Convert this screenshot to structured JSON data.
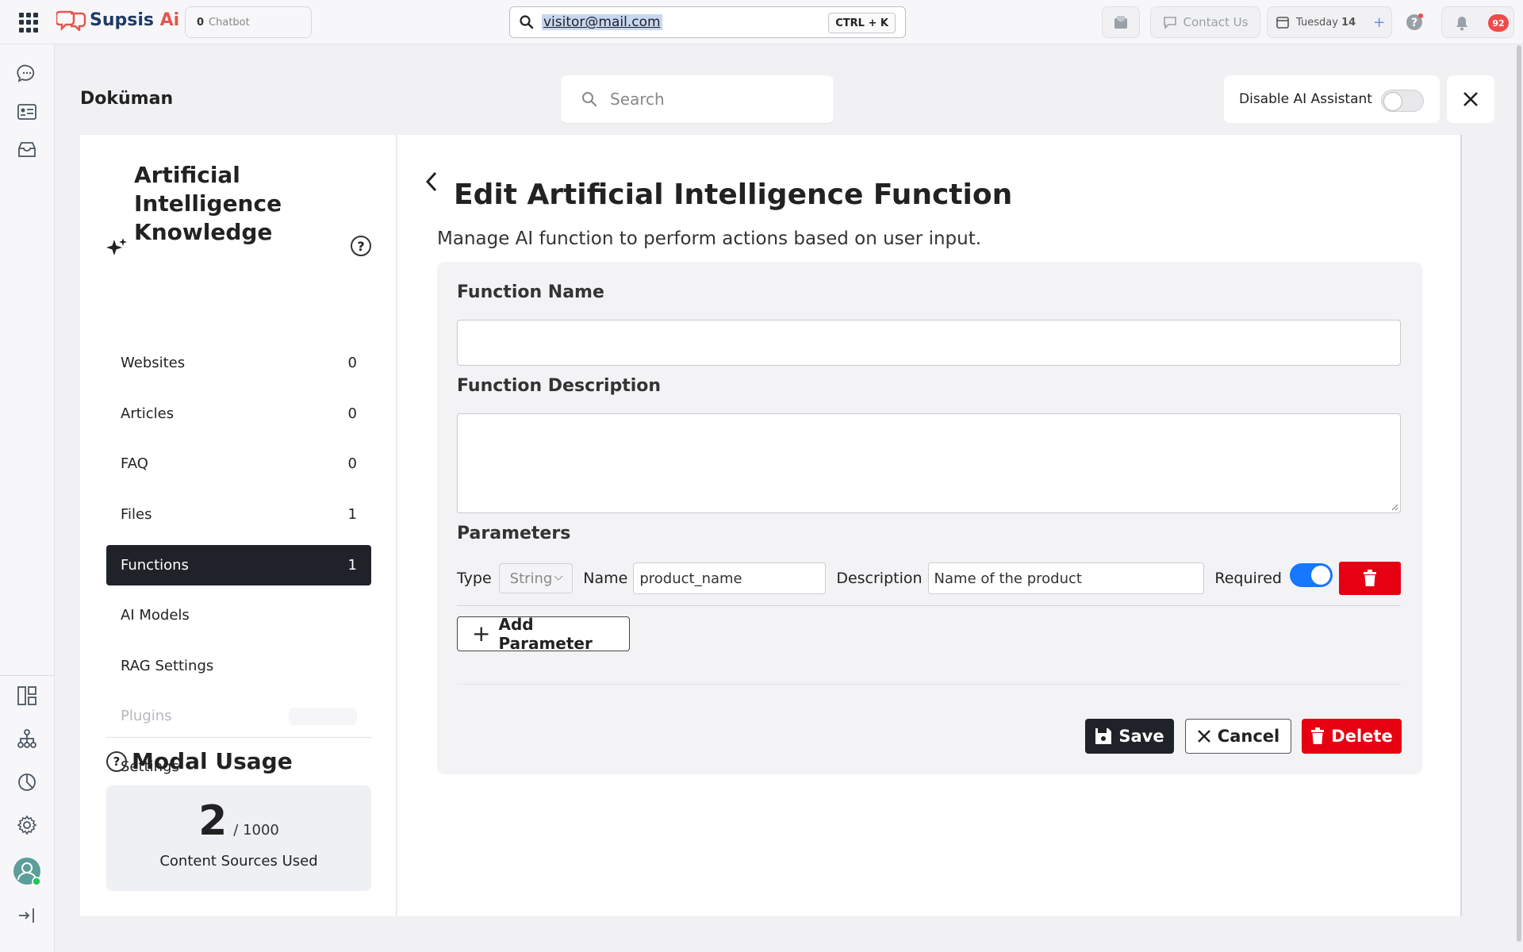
{
  "topbar": {
    "logo": {
      "name": "Supsis",
      "suffix": " Ai"
    },
    "chatbot": {
      "count": "0",
      "label": "Chatbot"
    },
    "search": {
      "value": "visitor@mail.com",
      "shortcut": "CTRL + K"
    },
    "contact_us": "Contact Us",
    "date": {
      "day": "Tuesday",
      "num": "14"
    },
    "notifications": "92"
  },
  "header": {
    "title": "Doküman",
    "search_placeholder": "Search",
    "disable_ai_label": "Disable AI Assistant"
  },
  "knowledge": {
    "title": "Artificial Intelligence Knowledge",
    "items": [
      {
        "label": "Websites",
        "count": "0"
      },
      {
        "label": "Articles",
        "count": "0"
      },
      {
        "label": "FAQ",
        "count": "0"
      },
      {
        "label": "Files",
        "count": "1"
      },
      {
        "label": "Functions",
        "count": "1"
      },
      {
        "label": "AI Models",
        "count": ""
      },
      {
        "label": "RAG Settings",
        "count": ""
      },
      {
        "label": "Plugins",
        "count": ""
      },
      {
        "label": "Settings",
        "count": ""
      }
    ],
    "usage": {
      "title": "Modal Usage",
      "used": "2",
      "total": "/ 1000",
      "label": "Content Sources Used"
    }
  },
  "editor": {
    "title": "Edit Artificial Intelligence Function",
    "subtitle": "Manage AI function to perform actions based on user input.",
    "function_name_label": "Function Name",
    "function_name_value": "",
    "function_description_label": "Function Description",
    "function_description_value": "",
    "parameters_label": "Parameters",
    "parameter": {
      "type_label": "Type",
      "type_value": "String",
      "name_label": "Name",
      "name_value": "product_name",
      "description_label": "Description",
      "description_value": "Name of the product",
      "required_label": "Required"
    },
    "add_parameter": "Add Parameter",
    "save": "Save",
    "cancel": "Cancel",
    "delete": "Delete"
  },
  "colors": {
    "accent": "#1677ff",
    "danger": "#e60012",
    "dark": "#1f2329"
  }
}
